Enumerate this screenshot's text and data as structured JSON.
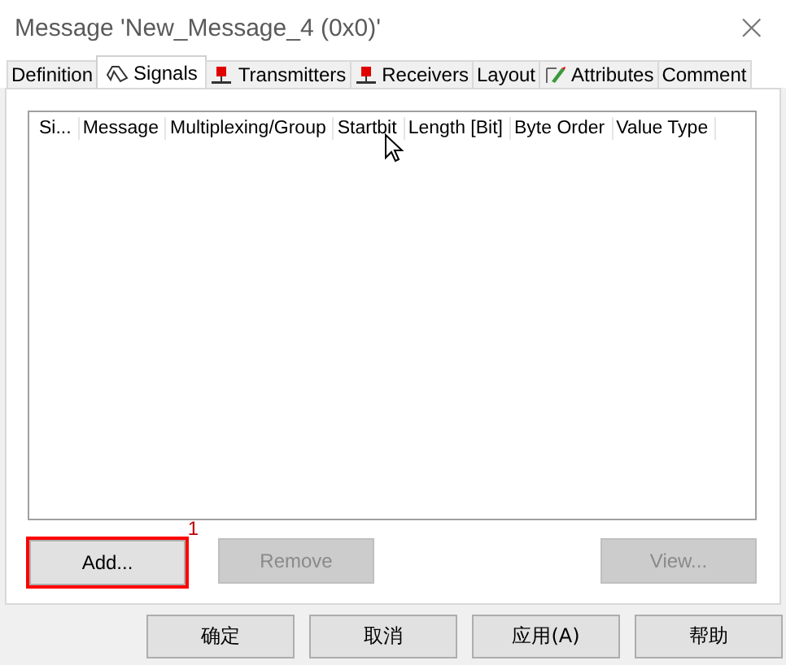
{
  "window": {
    "title": "Message 'New_Message_4 (0x0)'",
    "close": "×"
  },
  "tabs": [
    {
      "label": "Definition",
      "kind": "plain",
      "selected": false
    },
    {
      "label": "Signals",
      "kind": "signal",
      "selected": true
    },
    {
      "label": "Transmitters",
      "kind": "node",
      "selected": false
    },
    {
      "label": "Receivers",
      "kind": "node",
      "selected": false
    },
    {
      "label": "Layout",
      "kind": "plain",
      "selected": false
    },
    {
      "label": "Attributes",
      "kind": "attribute",
      "selected": false
    },
    {
      "label": "Comment",
      "kind": "plain",
      "selected": false
    }
  ],
  "table": {
    "columns": [
      "Si...",
      "Message",
      "Multiplexing/Group",
      "Startbit",
      "Length [Bit]",
      "Byte Order",
      "Value Type"
    ]
  },
  "buttons": [
    {
      "label": "Add...",
      "disabled": false,
      "highlighted": true,
      "annotation": "1"
    },
    {
      "label": "Remove",
      "disabled": true,
      "highlighted": false
    },
    {
      "label": "View...",
      "disabled": true,
      "highlighted": false
    }
  ],
  "dialog_buttons": [
    "确定",
    "取消",
    "应用(A)",
    "帮助"
  ]
}
